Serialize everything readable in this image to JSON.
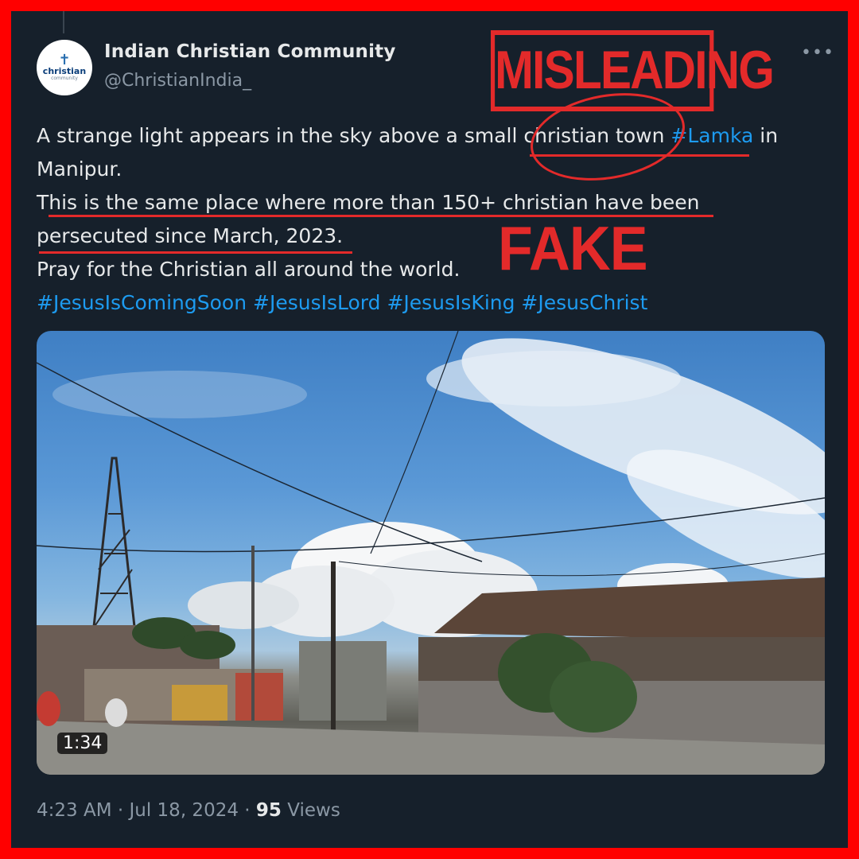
{
  "tweet": {
    "author_name": "Indian Christian Community",
    "handle": "@ChristianIndia_",
    "avatar_text": "christian",
    "avatar_subtext": "community",
    "more_label": "•••",
    "text_line1_a": "A strange light appears in the sky above a small ",
    "text_line1_b": "christian town",
    "text_line1_tag": "#Lamka",
    "text_line1_c": " in",
    "text_line2": "Manipur.",
    "text_line3": "This is the same place where more than 150+ christian have been",
    "text_line4": "persecuted since March, 2023.",
    "text_line5": "Pray for the Christian all around the world.",
    "hashtags": "#JesusIsComingSoon #JesusIsLord #JesusIsKing #JesusChrist",
    "video_duration": "1:34",
    "time": "4:23 AM",
    "date": "Jul 18, 2024",
    "views_count": "95",
    "views_label": "Views",
    "separator": " · "
  },
  "overlay": {
    "stamp_misleading": "MISLEADING",
    "stamp_fake": "FAKE"
  },
  "colors": {
    "background": "#16202b",
    "frame": "#ff0000",
    "accent": "#1d9bf0",
    "stamp": "#e32a2a"
  }
}
